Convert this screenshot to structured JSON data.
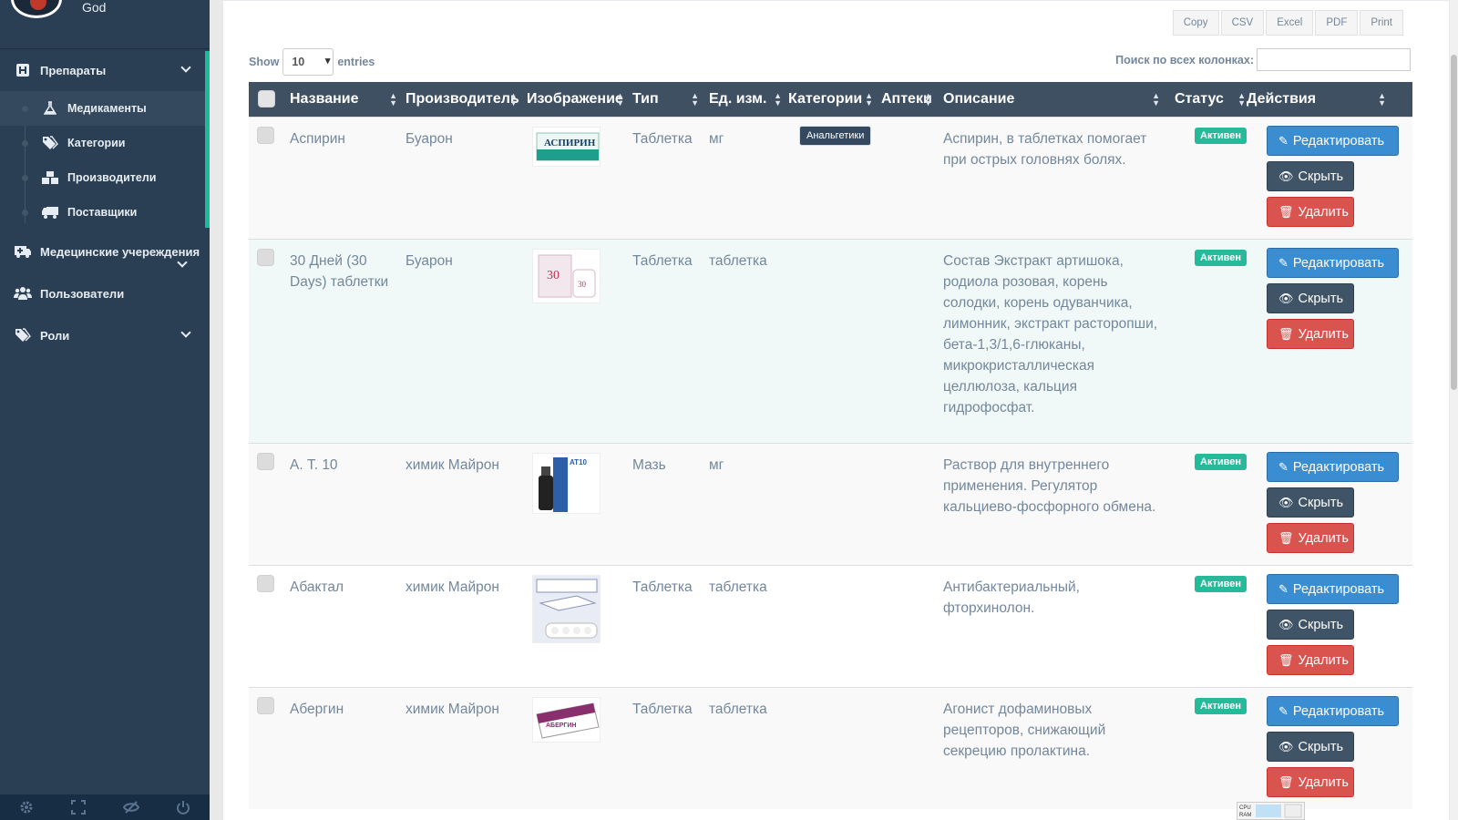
{
  "sidebar": {
    "profile_name": "God",
    "menu": [
      {
        "label": "Препараты",
        "icon": "hospital-icon"
      },
      {
        "label": "Медецинские учереждения",
        "icon": "ambulance-icon"
      },
      {
        "label": "Пользователи",
        "icon": "users-icon"
      },
      {
        "label": "Роли",
        "icon": "tags-icon"
      }
    ],
    "submenu": [
      {
        "label": "Медикаменты",
        "icon": "flask-icon",
        "active": true
      },
      {
        "label": "Категории",
        "icon": "tags-icon"
      },
      {
        "label": "Производители",
        "icon": "cubes-icon"
      },
      {
        "label": "Поставщики",
        "icon": "truck-icon"
      }
    ],
    "footer_icons": [
      "settings-icon",
      "fullscreen-icon",
      "lock-icon",
      "logout-icon"
    ]
  },
  "toolbar": {
    "export_buttons": [
      "Copy",
      "CSV",
      "Excel",
      "PDF",
      "Print"
    ],
    "show_label": "Show",
    "show_value": "10",
    "entries_label": "entries",
    "search_label": "Поиск по всех колонках:",
    "search_value": ""
  },
  "table": {
    "columns": [
      "Название",
      "Производитель",
      "Изображение",
      "Тип",
      "Ед. изм.",
      "Категории",
      "Аптеки",
      "Описание",
      "Статус",
      "Действия"
    ],
    "actions": {
      "edit": "Редактировать",
      "hide": "Скрыть",
      "delete": "Удалить"
    },
    "rows": [
      {
        "name": "Аспирин",
        "manufacturer": "Буарон",
        "image": "aspirin-box",
        "type": "Таблетка",
        "unit": "мг",
        "category": "Анальгетики",
        "pharmacies": "",
        "description": "Аспирин, в таблетках помогает при острых головнях болях.",
        "status": "Активен"
      },
      {
        "name": "30 Дней (30 Days) таблетки",
        "manufacturer": "Буарон",
        "image": "30-days-box",
        "type": "Таблетка",
        "unit": "таблетка",
        "category": "",
        "pharmacies": "",
        "description": "Состав Экстракт артишока, родиола розовая, корень солодки, корень одуванчика, лимонник, экстракт расторопши, бета-1,3/1,6-глюканы, микрокристаллическая целлюлоза, кальция гидрофосфат.",
        "status": "Активен"
      },
      {
        "name": "А. Т. 10",
        "manufacturer": "химик Майрон",
        "image": "at10-bottle",
        "type": "Мазь",
        "unit": "мг",
        "category": "",
        "pharmacies": "",
        "description": "Раствор для внутреннего применения. Регулятор кальциево-фосфорного обмена.",
        "status": "Активен"
      },
      {
        "name": "Абактал",
        "manufacturer": "химик Майрон",
        "image": "abaktal-box",
        "type": "Таблетка",
        "unit": "таблетка",
        "category": "",
        "pharmacies": "",
        "description": "Антибактериальный, фторхинолон.",
        "status": "Активен"
      },
      {
        "name": "Абергин",
        "manufacturer": "химик Майрон",
        "image": "abergin-box",
        "type": "Таблетка",
        "unit": "таблетка",
        "category": "",
        "pharmacies": "",
        "description": "Агонист дофаминовых рецепторов, снижающий секрецию пролактина.",
        "status": "Активен"
      }
    ]
  },
  "colors": {
    "sidebar": "#2a3f54",
    "accent": "#1abb9c",
    "header": "#3e5062",
    "edit": "#3a8dd0",
    "hide": "#405467",
    "delete": "#d9534f",
    "status": "#26b99a"
  }
}
